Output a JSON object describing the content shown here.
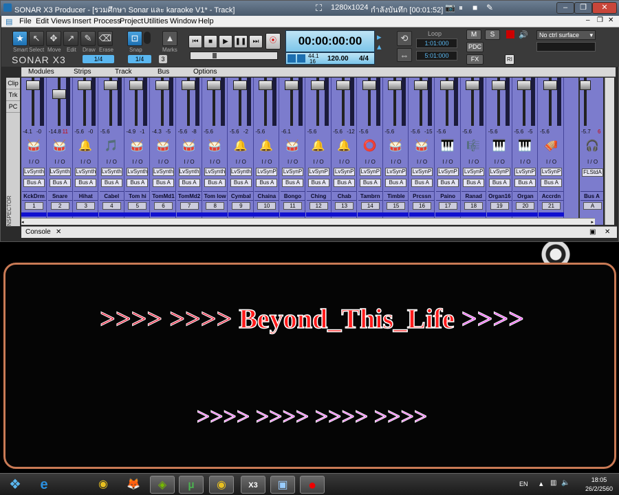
{
  "window": {
    "title": "SONAR X3 Producer - [รวมศึกษา Sonar และ karaoke V1* - Track]",
    "resolution": "1280x1024",
    "recording": "กำลังบันทึก [00:01:52]"
  },
  "menu": [
    "File",
    "Edit",
    "Views",
    "Insert",
    "Process",
    "Project",
    "Utilities",
    "Window",
    "Help"
  ],
  "tools": [
    {
      "label": "Smart",
      "icon": "★"
    },
    {
      "label": "Select",
      "icon": "↖"
    },
    {
      "label": "Move",
      "icon": "✥"
    },
    {
      "label": "Edit",
      "icon": "↗"
    },
    {
      "label": "Draw",
      "icon": "✎"
    },
    {
      "label": "Erase",
      "icon": "⌫"
    }
  ],
  "tool_fraction": "1/4",
  "snap": {
    "label": "Snap",
    "value": "1/4",
    "count": "3"
  },
  "marks_label": "Marks",
  "brand": "SONAR X3",
  "transport": {
    "time": "00:00:00:00",
    "sample_rate": "44.1",
    "bit_depth": "16",
    "tempo": "120.00",
    "meter": "4/4"
  },
  "loop": {
    "label": "Loop",
    "start": "1:01:000",
    "end": "5:01:000"
  },
  "right_buttons": {
    "m": "M",
    "s": "S",
    "pdc": "PDC",
    "fx": "FX",
    "ri": "RI",
    "ctrl_surface": "No ctrl surface"
  },
  "strip_menus": [
    "Modules",
    "Strips",
    "Track",
    "Bus",
    "Options"
  ],
  "side_tabs": [
    "Clip",
    "Trk",
    "PC"
  ],
  "inspector_label": "INSPECTOR",
  "console_tab": "Console",
  "io_label": "I / O",
  "strips": [
    {
      "name": "KckDrm",
      "num": "1",
      "vol": "-4.1",
      "pk": "-0",
      "synth": "LvSynth",
      "bus": "Bus A",
      "icon": "🥁",
      "fader": 0.08
    },
    {
      "name": "Snare",
      "num": "2",
      "vol": "-14.8",
      "pk": "11",
      "hot": true,
      "synth": "LvSynth",
      "bus": "Bus A",
      "icon": "🥁",
      "fader": 0.3
    },
    {
      "name": "Hihat",
      "num": "3",
      "vol": "-5.6",
      "pk": "-0",
      "synth": "LvSynth",
      "bus": "Bus A",
      "icon": "🔔",
      "fader": 0.08
    },
    {
      "name": "Cabel",
      "num": "4",
      "vol": "-5.6",
      "pk": "",
      "synth": "LvSynth",
      "bus": "Bus A",
      "icon": "🎵",
      "fader": 0.08
    },
    {
      "name": "Tom hi",
      "num": "5",
      "vol": "-4.9",
      "pk": "-1",
      "synth": "LvSynth",
      "bus": "Bus A",
      "icon": "🥁",
      "fader": 0.08
    },
    {
      "name": "TomMd1",
      "num": "6",
      "vol": "-4.3",
      "pk": "-5",
      "synth": "LvSynth",
      "bus": "Bus A",
      "icon": "🥁",
      "fader": 0.08
    },
    {
      "name": "TomMd2",
      "num": "7",
      "vol": "-5.6",
      "pk": "-8",
      "synth": "LvSynth",
      "bus": "Bus A",
      "icon": "🥁",
      "fader": 0.08
    },
    {
      "name": "Tom low",
      "num": "8",
      "vol": "-5.6",
      "pk": "",
      "synth": "LvSynth",
      "bus": "Bus A",
      "icon": "🥁",
      "fader": 0.08
    },
    {
      "name": "Cymbal",
      "num": "9",
      "vol": "-5.6",
      "pk": "-2",
      "synth": "LvSynth",
      "bus": "Bus A",
      "icon": "🔔",
      "fader": 0.08
    },
    {
      "name": "Chaina",
      "num": "10",
      "vol": "-5.6",
      "pk": "",
      "synth": "LvSynP",
      "bus": "Bus A",
      "icon": "🔔",
      "fader": 0.08
    },
    {
      "name": "Bongo",
      "num": "11",
      "vol": "-6.1",
      "pk": "",
      "synth": "LvSynP",
      "bus": "Bus A",
      "icon": "🥁",
      "fader": 0.08
    },
    {
      "name": "Ching",
      "num": "12",
      "vol": "-5.6",
      "pk": "",
      "synth": "LvSynP",
      "bus": "Bus A",
      "icon": "🔔",
      "fader": 0.08
    },
    {
      "name": "Chab",
      "num": "13",
      "vol": "-5.6",
      "pk": "-12",
      "synth": "LvSynP",
      "bus": "Bus A",
      "icon": "🔔",
      "fader": 0.08
    },
    {
      "name": "Tambrn",
      "num": "14",
      "vol": "-5.6",
      "pk": "",
      "synth": "LvSynP",
      "bus": "Bus A",
      "icon": "⭕",
      "fader": 0.08
    },
    {
      "name": "Timble",
      "num": "15",
      "vol": "-5.6",
      "pk": "",
      "synth": "LvSynP",
      "bus": "Bus A",
      "icon": "🥁",
      "fader": 0.08
    },
    {
      "name": "Prcssn",
      "num": "16",
      "vol": "-5.6",
      "pk": "-15",
      "synth": "LvSynP",
      "bus": "Bus A",
      "icon": "🥁",
      "fader": 0.08
    },
    {
      "name": "Paino",
      "num": "17",
      "vol": "-5.6",
      "pk": "",
      "synth": "LvSynP",
      "bus": "Bus A",
      "icon": "🎹",
      "fader": 0.08
    },
    {
      "name": "Ranad",
      "num": "18",
      "vol": "-5.6",
      "pk": "",
      "synth": "LvSynP",
      "bus": "Bus A",
      "icon": "🎼",
      "fader": 0.08
    },
    {
      "name": "Organ16",
      "num": "19",
      "vol": "-5.6",
      "pk": "",
      "synth": "LvSynP",
      "bus": "Bus A",
      "icon": "🎹",
      "fader": 0.08
    },
    {
      "name": "Organ",
      "num": "20",
      "vol": "-5.6",
      "pk": "-5",
      "synth": "LvSynP",
      "bus": "Bus A",
      "icon": "🎹",
      "fader": 0.08
    },
    {
      "name": "Accrdn",
      "num": "21",
      "vol": "-5.6",
      "pk": "",
      "synth": "LvSynP",
      "bus": "Bus A",
      "icon": "🪗",
      "fader": 0.08
    }
  ],
  "bus_strip": {
    "name": "Bus A",
    "num": "A",
    "vol": "-5.7",
    "pk": "6",
    "synth": "FLStdA",
    "icon": "🎧"
  },
  "karaoke": {
    "line1_left": ">>>> >>>>",
    "line1_word": "Beyond_This_Life",
    "line1_right": ">>>>",
    "line2": ">>>> >>>> >>>> >>>>"
  },
  "taskbar": {
    "items": [
      {
        "name": "start",
        "icon": "❖"
      },
      {
        "name": "ie",
        "icon": "e"
      },
      {
        "name": "chrome",
        "icon": "◉"
      },
      {
        "name": "firefox",
        "icon": "🦊"
      },
      {
        "name": "nvidia",
        "icon": "◈"
      },
      {
        "name": "utorrent",
        "icon": "µ"
      },
      {
        "name": "chrome2",
        "icon": "◉"
      },
      {
        "name": "sonar",
        "icon": "X3"
      },
      {
        "name": "app",
        "icon": "▣"
      },
      {
        "name": "recorder",
        "icon": "●"
      }
    ],
    "lang": "EN",
    "time": "18:05",
    "date": "26/2/2560"
  }
}
